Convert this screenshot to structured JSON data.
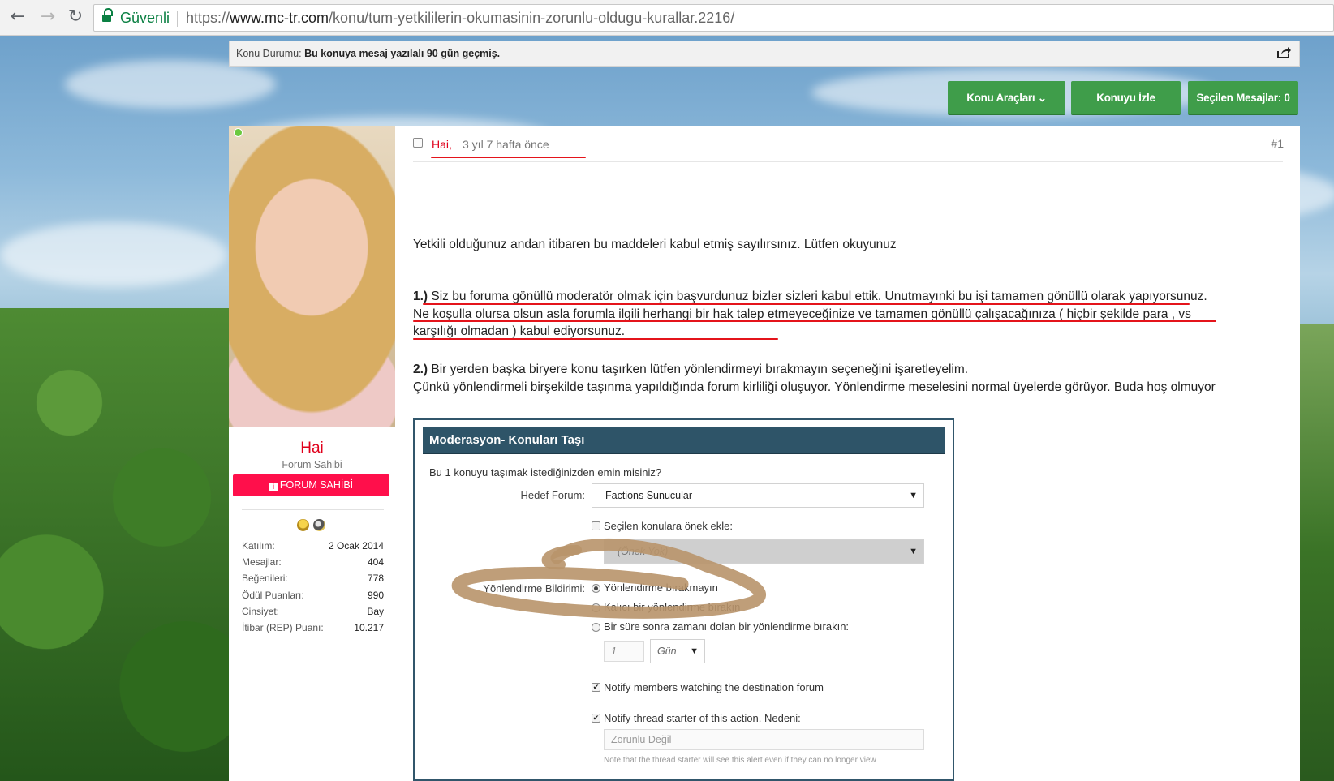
{
  "browser": {
    "secure_label": "Güvenli",
    "url_scheme": "https://",
    "url_host": "www.mc-tr.com",
    "url_path": "/konu/tum-yetkililerin-okumasinin-zorunlu-oldugu-kurallar.2216/"
  },
  "thread": {
    "status_label": "Konu Durumu:",
    "status_value": "Bu konuya mesaj yazılalı 90 gün geçmiş.",
    "tools": {
      "thread_tools": "Konu Araçları ⌄",
      "watch": "Konuyu İzle",
      "selected": "Seçilen Mesajlar: 0"
    }
  },
  "author": {
    "name": "Hai",
    "title": "Forum Sahibi",
    "rank": "FORUM SAHİBİ",
    "stats": [
      {
        "label": "Katılım:",
        "value": "2 Ocak 2014"
      },
      {
        "label": "Mesajlar:",
        "value": "404"
      },
      {
        "label": "Beğenileri:",
        "value": "778"
      },
      {
        "label": "Ödül Puanları:",
        "value": "990"
      },
      {
        "label": "Cinsiyet:",
        "value": "Bay"
      },
      {
        "label": "İtibar (REP) Puanı:",
        "value": "10.217"
      }
    ]
  },
  "post": {
    "author": "Hai",
    "date": "3 yıl 7 hafta önce",
    "number": "#1",
    "intro": "Yetkili olduğunuz andan itibaren bu maddeleri kabul etmiş sayılırsınız. Lütfen okuyunuz",
    "rule1_num": "1.)",
    "rule1": " Siz bu foruma gönüllü moderatör olmak için başvurdunuz bizler sizleri kabul ettik. Unutmayınki bu işi tamamen gönüllü olarak yapıyorsunuz. Ne koşulla olursa olsun asla forumla ilgili herhangi bir hak talep etmeyeceğinize ve tamamen gönüllü çalışacağınıza ( hiçbir şekilde para , vs karşılığı olmadan ) kabul ediyorsunuz.",
    "rule2_num": "2.)",
    "rule2_line1": " Bir yerden başka biryere konu taşırken lütfen yönlendirmeyi bırakmayın seçeneğini işaretleyelim.",
    "rule2_line2": "Çünkü yönlendirmeli birşekilde taşınma yapıldığında forum kirliliği oluşuyor. Yönlendirme meselesini normal üyelerde görüyor. Buda hoş olmuyor"
  },
  "dialog": {
    "title": "Moderasyon- Konuları Taşı",
    "question": "Bu 1 konuyu taşımak istediğinizden emin misiniz?",
    "target_label": "Hedef Forum:",
    "target_value": "Factions Sunucular",
    "prefix_check": "Seçilen konulara önek ekle:",
    "prefix_value": "(Önek Yok)",
    "redirect_label": "Yönlendirme Bildirimi:",
    "redirect_options": [
      "Yönlendirme bırakmayın",
      "Kalıcı bir yönlendirme bırakın",
      "Bir süre sonra zamanı dolan bir yönlendirme bırakın:"
    ],
    "expire_amount": "1",
    "expire_unit": "Gün",
    "notify_watchers": "Notify members watching the destination forum",
    "notify_starter": "Notify thread starter of this action. Nedeni:",
    "reason_placeholder": "Zorunlu Değil",
    "note": "Note that the thread starter will see this alert even if they can no longer view"
  },
  "colors": {
    "accent_green": "#3f9d4a",
    "author_red": "#e0001b",
    "badge_pink": "#ff0f4b",
    "dialog_header": "#2e5468"
  }
}
